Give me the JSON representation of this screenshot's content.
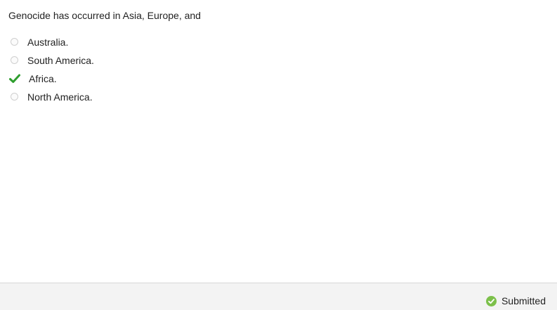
{
  "question": {
    "text": "Genocide has occurred in Asia, Europe, and"
  },
  "options": [
    {
      "label": "Australia.",
      "selected": false
    },
    {
      "label": "South America.",
      "selected": false
    },
    {
      "label": "Africa.",
      "selected": true
    },
    {
      "label": "North America.",
      "selected": false
    }
  ],
  "status": {
    "text": "Submitted",
    "icon": "check-circle-icon"
  },
  "colors": {
    "check": "#2e9e2e",
    "status_icon": "#7cc04a",
    "footer_bg": "#f3f3f3"
  }
}
